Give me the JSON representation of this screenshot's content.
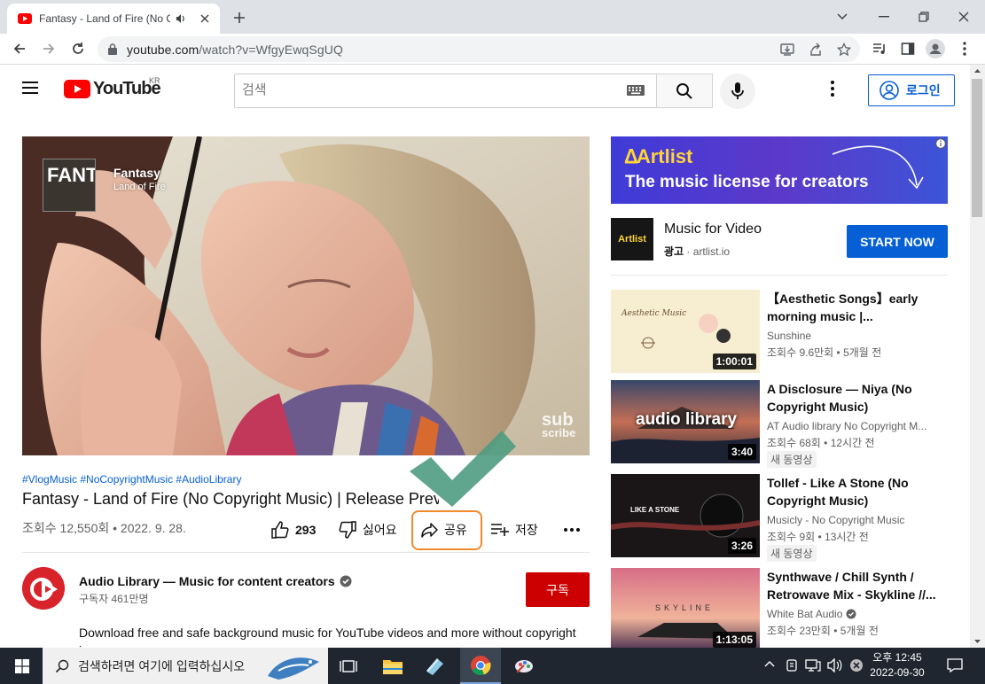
{
  "browser": {
    "tab_title": "Fantasy - Land of Fire (No Copyright Music)",
    "url_host": "youtube.com",
    "url_path": "/watch?v=WfgyEwqSgUQ"
  },
  "youtube": {
    "logo_text": "YouTube",
    "country_code": "KR",
    "search_placeholder": "검색",
    "login_label": "로그인"
  },
  "video": {
    "overlay_title": "Fantasy",
    "overlay_subtitle": "Land of Fire",
    "overlay_thumb_text": "FANTASY",
    "watermark_line1": "sub",
    "watermark_line2": "scribe",
    "hashtags": "#VlogMusic #NoCopyrightMusic #AudioLibrary",
    "title": "Fantasy - Land of Fire (No Copyright Music) | Release Preview",
    "views": "조회수 12,550회 • 2022. 9. 28.",
    "likes": "293",
    "dislike_label": "싫어요",
    "share_label": "공유",
    "save_label": "저장"
  },
  "channel": {
    "name": "Audio Library — Music for content creators",
    "subscribers": "구독자 461만명",
    "subscribe_label": "구독",
    "description": "Download free and safe background music for YouTube videos and more without copyright issues."
  },
  "ad": {
    "brand": "Artlist",
    "tagline": "The music license for creators",
    "logo_text": "Artlist",
    "title": "Music for Video",
    "label": "광고",
    "domain": "artlist.io",
    "cta": "START NOW"
  },
  "recommendations": [
    {
      "title": "【Aesthetic Songs】early morning music |...",
      "channel": "Sunshine",
      "meta": "조회수 9.6만회 • 5개월 전",
      "duration": "1:00:01",
      "badge": "",
      "thumb_text": "Aesthetic Music"
    },
    {
      "title": "A Disclosure — Niya (No Copyright Music)",
      "channel": "AT Audio library No Copyright M...",
      "meta": "조회수 68회 • 12시간 전",
      "duration": "3:40",
      "badge": "새 동영상",
      "thumb_text": "audio library"
    },
    {
      "title": "Tollef - Like A Stone (No Copyright Music)",
      "channel": "Musicly - No Copyright Music",
      "meta": "조회수 9회 • 13시간 전",
      "duration": "3:26",
      "badge": "새 동영상",
      "thumb_text": "LIKE A STONE"
    },
    {
      "title": "Synthwave / Chill Synth / Retrowave Mix - Skykline //...",
      "channel": "White Bat Audio",
      "meta": "조회수 23만회 • 5개월 전",
      "duration": "1:13:05",
      "badge": "",
      "thumb_text": "SKYLINE"
    }
  ],
  "taskbar": {
    "search_placeholder": "검색하려면 여기에 입력하십시오",
    "time": "오후 12:45",
    "date": "2022-09-30"
  }
}
